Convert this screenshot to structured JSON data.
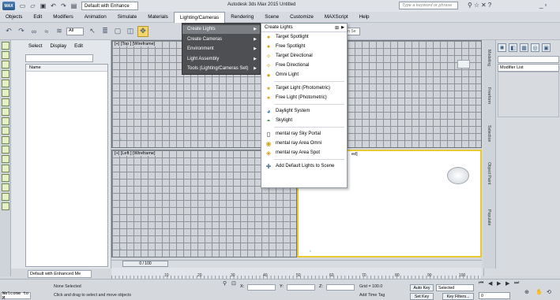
{
  "titlebar": {
    "workspace": "Default with Enhance",
    "title": "Autodesk 3ds Max 2015   Untitled",
    "search_placeholder": "Type a keyword or phrase"
  },
  "menubar": {
    "items": [
      "Objects",
      "Edit",
      "Modifiers",
      "Animation",
      "Simulate",
      "Materials",
      "Lighting/Cameras",
      "Rendering",
      "Scene",
      "Customize",
      "MAXScript",
      "Help"
    ],
    "active": "Lighting/Cameras"
  },
  "toolbar": {
    "selection_filter": "All",
    "create_selection_set": "Create Selection Se"
  },
  "explorer": {
    "tabs": [
      "Select",
      "Display",
      "Edit"
    ],
    "column_header": "Name"
  },
  "viewports": {
    "top": "[+] [Top ] [Wireframe]",
    "left": "[+] [Left ] [Wireframe]",
    "persp_suffix": "ed]"
  },
  "lighting_menu": {
    "items": [
      {
        "label": "Create Lights",
        "selected": true
      },
      {
        "label": "Create Cameras",
        "selected": false
      },
      {
        "label": "Environment",
        "selected": false
      },
      {
        "label": "Light Assembly",
        "selected": false
      },
      {
        "label": "Tools (Lighting/Cameras Set)",
        "selected": false
      }
    ]
  },
  "create_lights_menu": {
    "header": "Create Lights",
    "groups": [
      [
        {
          "label": "Target Spotlight",
          "icon": "spotlight-icon"
        },
        {
          "label": "Free Spotlight",
          "icon": "spotlight-icon"
        },
        {
          "label": "Target Directional",
          "icon": "directional-light-icon"
        },
        {
          "label": "Free Directional",
          "icon": "directional-light-icon"
        },
        {
          "label": "Omni Light",
          "icon": "omni-light-icon"
        }
      ],
      [
        {
          "label": "Target Light (Photometric)",
          "icon": "photometric-light-icon"
        },
        {
          "label": "Free Light (Photometric)",
          "icon": "photometric-light-icon"
        }
      ],
      [
        {
          "label": "Daylight System",
          "icon": "daylight-icon"
        },
        {
          "label": "Skylight",
          "icon": "skylight-icon"
        }
      ],
      [
        {
          "label": "mental ray Sky Portal",
          "icon": "sky-portal-icon"
        },
        {
          "label": "mental ray Area Omni",
          "icon": "area-omni-icon"
        },
        {
          "label": "mental ray Area Spot",
          "icon": "area-spot-icon"
        }
      ],
      [
        {
          "label": "Add Default Lights to Scene",
          "icon": "default-lights-icon"
        }
      ]
    ]
  },
  "command_panel": {
    "modifier_list": "Modifier List",
    "ribbon_labels": [
      "Modeling",
      "Freeform",
      "Selection",
      "Object Paint",
      "Populate"
    ]
  },
  "timeline": {
    "slider": "0 / 100",
    "ticks": [
      "10",
      "20",
      "30",
      "40",
      "50",
      "60",
      "70",
      "80",
      "90",
      "100"
    ]
  },
  "status": {
    "workspace": "Default with Enhanced Me",
    "maxscript": "Welcome to M",
    "selection": "None Selected",
    "prompt": "Click and drag to select and move objects",
    "x_label": "X:",
    "y_label": "Y:",
    "z_label": "Z:",
    "grid": "Grid = 100.0",
    "add_time_tag": "Add Time Tag",
    "auto_key": "Auto Key",
    "set_key": "Set Key",
    "key_mode": "Selected",
    "key_filters": "Key Filters...",
    "frame": "0"
  }
}
